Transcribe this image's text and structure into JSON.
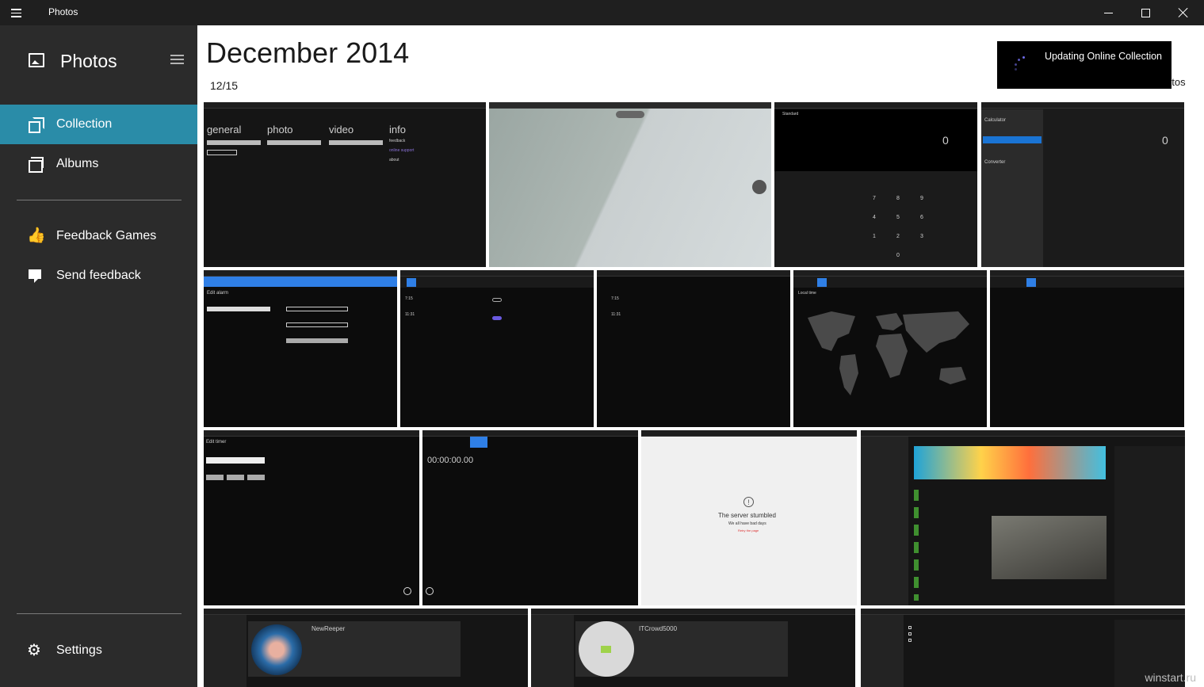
{
  "window": {
    "title": "Photos",
    "controls": {
      "minimize": "minimize",
      "maximize": "maximize",
      "close": "close"
    }
  },
  "sidebar": {
    "app_name": "Photos",
    "nav": [
      {
        "label": "Collection",
        "icon": "collection-icon",
        "active": true
      },
      {
        "label": "Albums",
        "icon": "albums-icon",
        "active": false
      }
    ],
    "extra": [
      {
        "label": "Feedback Games",
        "icon": "thumbs-up-icon"
      },
      {
        "label": "Send feedback",
        "icon": "feedback-icon"
      }
    ],
    "settings_label": "Settings"
  },
  "main": {
    "month_title": "December 2014",
    "date_label": "12/15",
    "toast": {
      "message": "Updating Online Collection"
    },
    "behind_text": "otos",
    "watermark": "winstart.ru"
  },
  "thumbnails": {
    "r1": {
      "cam_tabs": [
        "general",
        "photo",
        "video",
        "info"
      ],
      "cam_links": [
        "feedback",
        "online support",
        "about"
      ],
      "calc_mode": "Standard",
      "calc_display": "0",
      "calc_menu_head": "Calculator",
      "calc_converter": "Converter",
      "calc_keys": [
        "7",
        "8",
        "9",
        "4",
        "5",
        "6",
        "1",
        "2",
        "3",
        "0"
      ]
    },
    "r2": {
      "alarm_title": "Edit alarm",
      "local_time": "Local time",
      "alarm_times": [
        "7:15",
        "11:31"
      ]
    },
    "r3": {
      "timer_title": "Edit timer",
      "stopwatch": "00:00:00.00",
      "server_title": "The server stumbled",
      "server_sub": "We all have bad days",
      "server_link": "Retry the page"
    },
    "r4": {
      "profile_1": "NewReeper",
      "profile_2": "ITCrowd5000"
    }
  }
}
